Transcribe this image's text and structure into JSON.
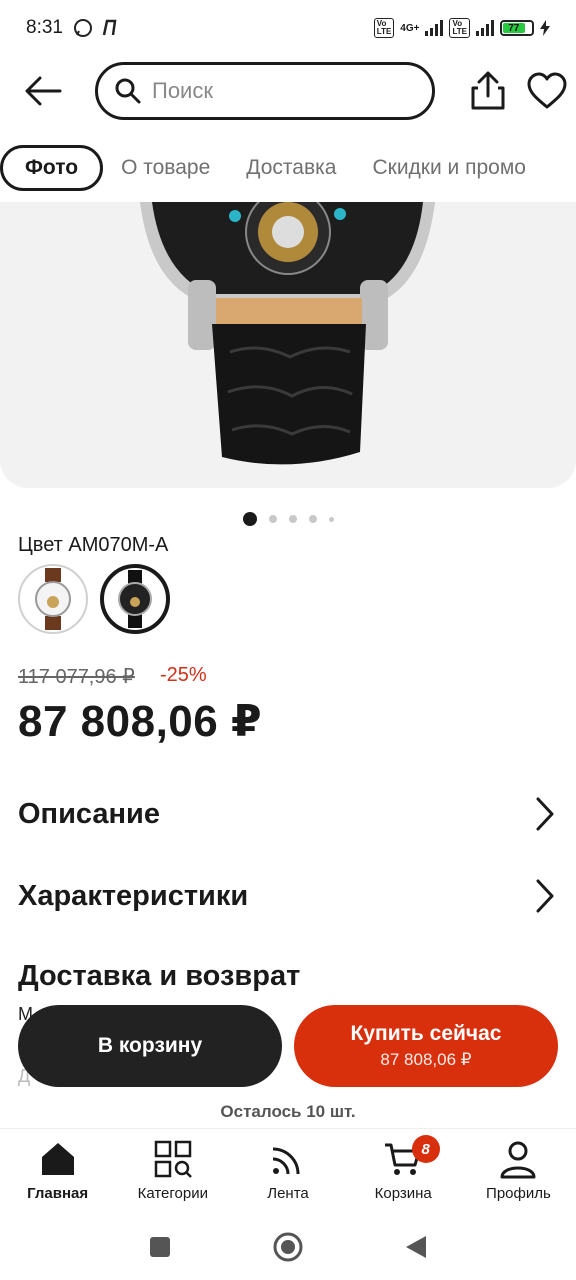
{
  "status_bar": {
    "time": "8:31",
    "network_1": "4G+",
    "battery": "77"
  },
  "search": {
    "placeholder": "Поиск"
  },
  "tabs": [
    {
      "label": "Фото"
    },
    {
      "label": "О товаре"
    },
    {
      "label": "Доставка"
    },
    {
      "label": "Скидки и промо"
    }
  ],
  "gallery": {
    "dot_count": 5,
    "active_index": 0
  },
  "product": {
    "color_label": "Цвет AM070M-A",
    "old_price": "117 077,96 ₽",
    "discount": "-25%",
    "price": "87 808,06 ₽"
  },
  "sections": {
    "description": "Описание",
    "specs": "Характеристики",
    "delivery": "Доставка и возврат"
  },
  "faded": {
    "line1": "М",
    "line2": "Д                                                   ол                              о",
    "line3": ""
  },
  "actions": {
    "cart": "В корзину",
    "buy": "Купить сейчас",
    "buy_price": "87 808,06 ₽",
    "stock": "Осталось 10 шт."
  },
  "bottom_nav": {
    "home": "Главная",
    "categories": "Категории",
    "feed": "Лента",
    "cart": "Корзина",
    "cart_badge": "8",
    "profile": "Профиль"
  },
  "colors": {
    "accent": "#d8300d",
    "dark": "#1a1a1a"
  }
}
